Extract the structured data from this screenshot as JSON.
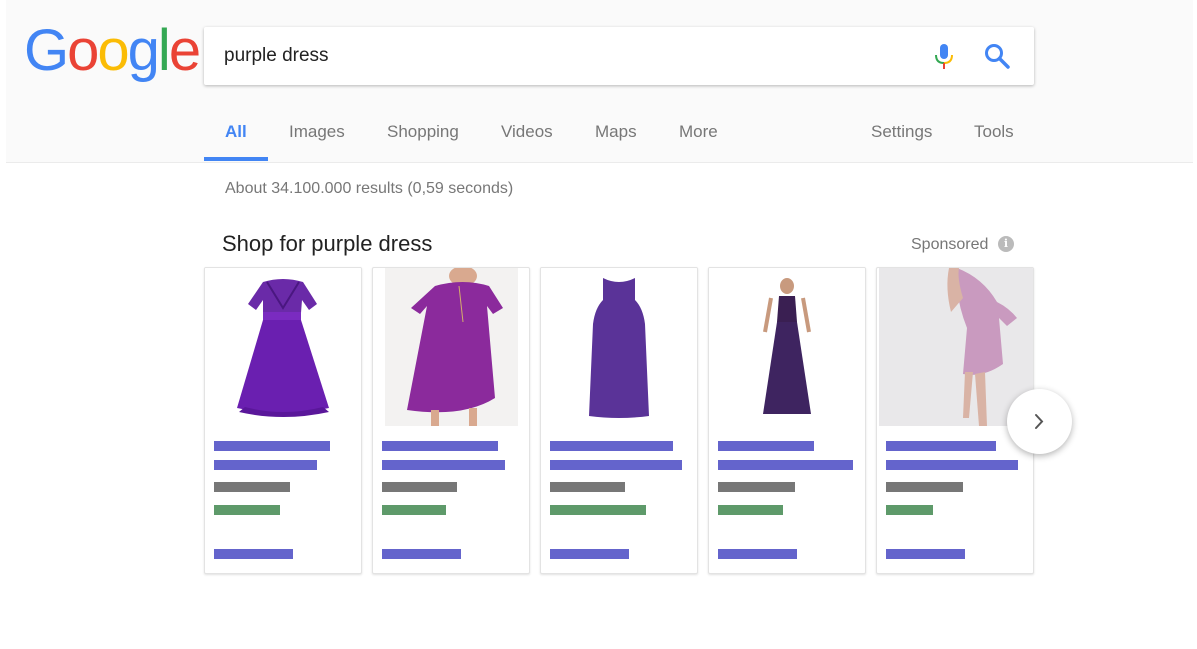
{
  "logo": {
    "letters": [
      "G",
      "o",
      "o",
      "g",
      "l",
      "e"
    ],
    "colors": [
      "#4285f4",
      "#ea4335",
      "#fbbc05",
      "#4285f4",
      "#34a853",
      "#ea4335"
    ]
  },
  "search": {
    "query": "purple dress"
  },
  "tabs": [
    {
      "label": "All",
      "active": true
    },
    {
      "label": "Images"
    },
    {
      "label": "Shopping"
    },
    {
      "label": "Videos"
    },
    {
      "label": "Maps"
    },
    {
      "label": "More"
    }
  ],
  "tools": {
    "settings": "Settings",
    "tools": "Tools"
  },
  "results": {
    "stats": "About 34.100.000 results (0,59 seconds)"
  },
  "shopping": {
    "title": "Shop for purple dress",
    "sponsored": "Sponsored",
    "info_icon": "i",
    "accent_colors": {
      "title_link": "#6464cc",
      "price": "#777777",
      "store": "#5e9a6a"
    },
    "products": [
      {
        "image": "purple lace skater dress"
      },
      {
        "image": "purple short-sleeve swing dress"
      },
      {
        "image": "purple sleeveless shift dress"
      },
      {
        "image": "dark purple maxi gown"
      },
      {
        "image": "lilac flutter-sleeve mini dress"
      }
    ]
  },
  "icons": {
    "mic": "mic-icon",
    "search": "search-icon",
    "next": "chevron-right-icon"
  },
  "colors": {
    "tab_active": "#4285f4",
    "header_bg": "#fafafa"
  }
}
